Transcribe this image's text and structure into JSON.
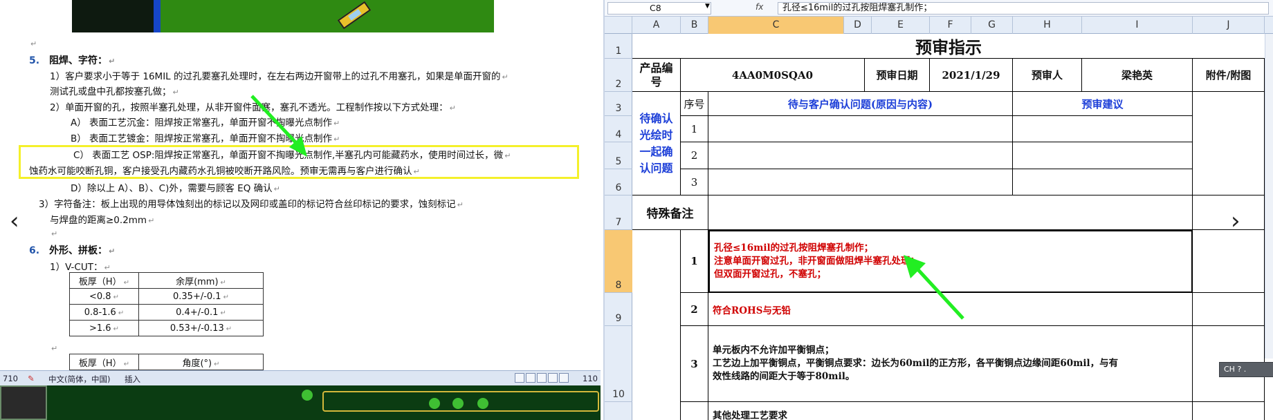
{
  "word": {
    "blank_marks": [
      "↵",
      "↵",
      "↵"
    ],
    "section5": {
      "num": "5.",
      "title": "阻焊、字符：",
      "line1a": "1）客户要求小于等于 16MIL 的过孔要塞孔处理时，在左右两边开窗带上的过孔不用塞孔，如果是单面开窗的",
      "line1b": "测试孔或盘中孔都按塞孔做；",
      "line2": "2）单面开窗的孔，按照半塞孔处理，从非开窗件面塞，塞孔不透光。工程制作按以下方式处理：",
      "lineA": "A）   表面工艺沉金：阻焊按正常塞孔，单面开窗不掏曝光点制作",
      "lineB": "B）   表面工艺镀金：阻焊按正常塞孔，单面开窗不掏曝光点制作",
      "lineC1": "C）   表面工艺 OSP:阻焊按正常塞孔，单面开窗不掏曝光点制作,半塞孔内可能藏药水，使用时间过长，微",
      "lineC2": "蚀药水可能咬断孔铜，客户接受孔内藏药水孔铜被咬断开路风险。预审无需再与客户进行确认",
      "lineD": "D）除以上 A）、B）、C)外，需要与顾客 EQ 确认",
      "line3a": "3）字符备注：板上出现的用导体蚀刻出的标记以及网印或盖印的标记符合丝印标记的要求，蚀刻标记",
      "line3b": "与焊盘的距离≥0.2mm"
    },
    "section6": {
      "num": "6.",
      "title": "外形、拼板：",
      "vcut_label": "1）V-CUT："
    },
    "vcut_table": {
      "headers": [
        "板厚（H）",
        "余厚(mm)"
      ],
      "rows": [
        [
          "<0.8",
          "0.35+/-0.1"
        ],
        [
          "0.8-1.6",
          "0.4+/-0.1"
        ],
        [
          ">1.6",
          "0.53+/-0.13"
        ]
      ]
    },
    "angle_table": {
      "headers": [
        "板厚（H）",
        "角度(°)"
      ]
    },
    "nav_prev": "‹",
    "status": {
      "page": "710",
      "language": "中文(简体，中国)",
      "mode": "插入",
      "zoom": "110"
    }
  },
  "excel": {
    "namebox": "C8",
    "fx": "fx",
    "formula": "孔径≤16mil的过孔按阻焊塞孔制作；",
    "columns": [
      "A",
      "B",
      "C",
      "D",
      "E",
      "F",
      "G",
      "H",
      "I",
      "J"
    ],
    "rows": [
      "1",
      "2",
      "3",
      "4",
      "5",
      "6",
      "7",
      "8",
      "9",
      "10"
    ],
    "title": "预审指示",
    "product_label": "产品编号",
    "product_value": "4AA0M0SQA0",
    "date_label": "预审日期",
    "date_value": "2021/1/29",
    "reviewer_label": "预审人",
    "reviewer_value": "梁艳英",
    "attach_label": "附件/附图",
    "pending_label": "待确认光绘时一起确认问题",
    "seq_label": "序号",
    "issue_header": "待与客户确认问题(原因与内容)",
    "suggest_header": "预审建议",
    "seq": [
      "1",
      "2",
      "3"
    ],
    "special_label": "特殊备注",
    "note1_num": "1",
    "note1_lines": [
      "孔径≤16mil的过孔按阻焊塞孔制作；",
      "注意单面开窗过孔，非开窗面做阻焊半塞孔处理；",
      "但双面开窗过孔，不塞孔；"
    ],
    "note2_num": "2",
    "note2": "符合ROHS与无铅",
    "note3_num": "3",
    "note3_lines": [
      "单元板内不允许加平衡铜点；",
      "工艺边上加平衡铜点，平衡铜点要求：边长为60mil的正方形，各平衡铜点边缘间距60mil，与有",
      "效性线路的间距大于等于80mil。"
    ],
    "note4": "其他处理工艺要求",
    "nav_next": "›",
    "ime": "CH ? ."
  },
  "colors": {
    "highlight": "#f4f02a",
    "arrow": "#22ee22",
    "red_text": "#d00000",
    "blue_text": "#1d3fd8",
    "selected_header": "#f8c873"
  }
}
